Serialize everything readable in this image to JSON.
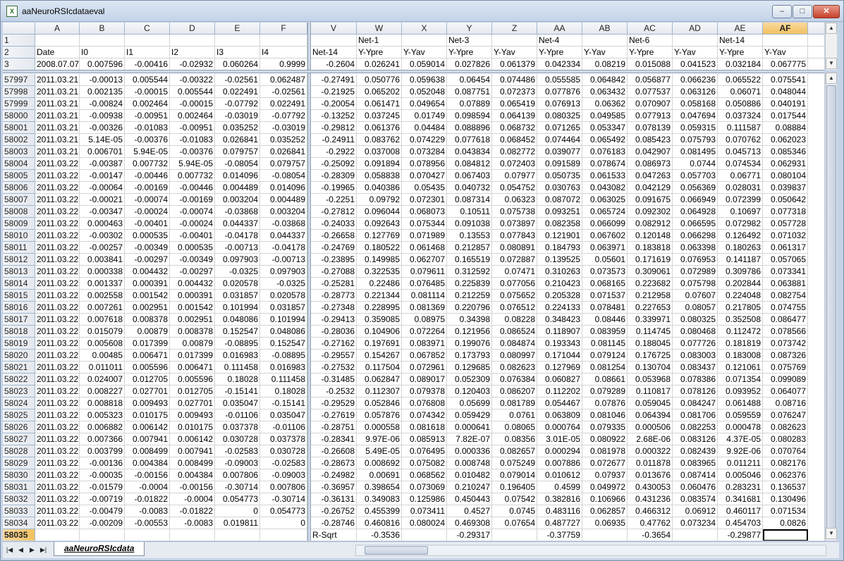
{
  "window": {
    "title": "aaNeuroRSIcdataeval",
    "app_icon": "excel-sheet-icon",
    "min_label": "–",
    "max_label": "□",
    "close_label": "✕"
  },
  "columns": [
    "A",
    "B",
    "C",
    "D",
    "E",
    "F",
    "V",
    "W",
    "X",
    "Y",
    "Z",
    "AA",
    "AB",
    "AC",
    "AD",
    "AE",
    "AF",
    "A"
  ],
  "selected_column": "AF",
  "header_rows": [
    {
      "n": "1",
      "cells": [
        "",
        "",
        "",
        "",
        "",
        "",
        "",
        "Net-1",
        "",
        "Net-3",
        "",
        "Net-4",
        "",
        "Net-6",
        "",
        "Net-14",
        "",
        ""
      ]
    },
    {
      "n": "2",
      "cells": [
        "Date",
        "I0",
        "I1",
        "I2",
        "I3",
        "I4",
        "Net-14",
        "Y-Ypre",
        "Y-Yav",
        "Y-Ypre",
        "Y-Yav",
        "Y-Ypre",
        "Y-Yav",
        "Y-Ypre",
        "Y-Yav",
        "Y-Ypre",
        "Y-Yav",
        ""
      ]
    },
    {
      "n": "3",
      "cells": [
        "2008.07.07",
        "0.007596",
        "-0.00416",
        "-0.02932",
        "0.060264",
        "0.9999",
        "-0.2604",
        "0.026241",
        "0.059014",
        "0.027826",
        "0.061379",
        "0.042334",
        "0.08219",
        "0.015088",
        "0.041523",
        "0.032184",
        "0.067775",
        ""
      ]
    }
  ],
  "data_rows": [
    {
      "n": "57997",
      "cells": [
        "2011.03.21",
        "-0.00013",
        "0.005544",
        "-0.00322",
        "-0.02561",
        "0.062487",
        "-0.27491",
        "0.050776",
        "0.059638",
        "0.06454",
        "0.074486",
        "0.055585",
        "0.064842",
        "0.056877",
        "0.066236",
        "0.065522",
        "0.075541"
      ]
    },
    {
      "n": "57998",
      "cells": [
        "2011.03.21",
        "0.002135",
        "-0.00015",
        "0.005544",
        "0.022491",
        "-0.02561",
        "-0.21925",
        "0.065202",
        "0.052048",
        "0.087751",
        "0.072373",
        "0.077876",
        "0.063432",
        "0.077537",
        "0.063126",
        "0.06071",
        "0.048044"
      ]
    },
    {
      "n": "57999",
      "cells": [
        "2011.03.21",
        "-0.00824",
        "0.002464",
        "-0.00015",
        "-0.07792",
        "0.022491",
        "-0.20054",
        "0.061471",
        "0.049654",
        "0.07889",
        "0.065419",
        "0.076913",
        "0.06362",
        "0.070907",
        "0.058168",
        "0.050886",
        "0.040191"
      ]
    },
    {
      "n": "58000",
      "cells": [
        "2011.03.21",
        "-0.00938",
        "-0.00951",
        "0.002464",
        "-0.03019",
        "-0.07792",
        "-0.13252",
        "0.037245",
        "0.01749",
        "0.098594",
        "0.064139",
        "0.080325",
        "0.049585",
        "0.077913",
        "0.047694",
        "0.037324",
        "0.017544"
      ]
    },
    {
      "n": "58001",
      "cells": [
        "2011.03.21",
        "-0.00326",
        "-0.01083",
        "-0.00951",
        "0.035252",
        "-0.03019",
        "-0.29812",
        "0.061376",
        "0.04484",
        "0.088896",
        "0.068732",
        "0.071265",
        "0.053347",
        "0.078139",
        "0.059315",
        "0.111587",
        "0.08884"
      ]
    },
    {
      "n": "58002",
      "cells": [
        "2011.03.21",
        "5.14E-05",
        "-0.00376",
        "-0.01083",
        "0.026841",
        "0.035252",
        "-0.24911",
        "0.083762",
        "0.074229",
        "0.077618",
        "0.068452",
        "0.074464",
        "0.065492",
        "0.085423",
        "0.075793",
        "0.070762",
        "0.062023"
      ]
    },
    {
      "n": "58003",
      "cells": [
        "2011.03.21",
        "0.006701",
        "5.94E-05",
        "-0.00376",
        "0.079757",
        "0.026841",
        "-0.2922",
        "0.037008",
        "0.073284",
        "0.043834",
        "0.082772",
        "0.039077",
        "0.076183",
        "0.042907",
        "0.081495",
        "0.045713",
        "0.085346"
      ]
    },
    {
      "n": "58004",
      "cells": [
        "2011.03.22",
        "-0.00387",
        "0.007732",
        "5.94E-05",
        "-0.08054",
        "0.079757",
        "-0.25092",
        "0.091894",
        "0.078956",
        "0.084812",
        "0.072403",
        "0.091589",
        "0.078674",
        "0.086973",
        "0.0744",
        "0.074534",
        "0.062931"
      ]
    },
    {
      "n": "58005",
      "cells": [
        "2011.03.22",
        "-0.00147",
        "-0.00446",
        "0.007732",
        "0.014096",
        "-0.08054",
        "-0.28309",
        "0.058838",
        "0.070427",
        "0.067403",
        "0.07977",
        "0.050735",
        "0.061533",
        "0.047263",
        "0.057703",
        "0.06771",
        "0.080104"
      ]
    },
    {
      "n": "58006",
      "cells": [
        "2011.03.22",
        "-0.00064",
        "-0.00169",
        "-0.00446",
        "0.004489",
        "0.014096",
        "-0.19965",
        "0.040386",
        "0.05435",
        "0.040732",
        "0.054752",
        "0.030763",
        "0.043082",
        "0.042129",
        "0.056369",
        "0.028031",
        "0.039837"
      ]
    },
    {
      "n": "58007",
      "cells": [
        "2011.03.22",
        "-0.00021",
        "-0.00074",
        "-0.00169",
        "0.003204",
        "0.004489",
        "-0.2251",
        "0.09792",
        "0.072301",
        "0.087314",
        "0.06323",
        "0.087072",
        "0.063025",
        "0.091675",
        "0.066949",
        "0.072399",
        "0.050642"
      ]
    },
    {
      "n": "58008",
      "cells": [
        "2011.03.22",
        "-0.00347",
        "-0.00024",
        "-0.00074",
        "-0.03868",
        "0.003204",
        "-0.27812",
        "0.096044",
        "0.068073",
        "0.10511",
        "0.075738",
        "0.093251",
        "0.065724",
        "0.092302",
        "0.064928",
        "0.10697",
        "0.077318"
      ]
    },
    {
      "n": "58009",
      "cells": [
        "2011.03.22",
        "0.000463",
        "-0.00401",
        "-0.00024",
        "0.044337",
        "-0.03868",
        "-0.24033",
        "0.092643",
        "0.075344",
        "0.091038",
        "0.073897",
        "0.082358",
        "0.066099",
        "0.082912",
        "0.066595",
        "0.072982",
        "0.057728"
      ]
    },
    {
      "n": "58010",
      "cells": [
        "2011.03.22",
        "-0.00302",
        "0.000535",
        "-0.00401",
        "-0.04178",
        "0.044337",
        "-0.26658",
        "0.127769",
        "0.071989",
        "0.13553",
        "0.077843",
        "0.121901",
        "0.067602",
        "0.120148",
        "0.066298",
        "0.126492",
        "0.071032"
      ]
    },
    {
      "n": "58011",
      "cells": [
        "2011.03.22",
        "-0.00257",
        "-0.00349",
        "0.000535",
        "-0.00713",
        "-0.04178",
        "-0.24769",
        "0.180522",
        "0.061468",
        "0.212857",
        "0.080891",
        "0.184793",
        "0.063971",
        "0.183818",
        "0.063398",
        "0.180263",
        "0.061317"
      ]
    },
    {
      "n": "58012",
      "cells": [
        "2011.03.22",
        "0.003841",
        "-0.00297",
        "-0.00349",
        "0.097903",
        "-0.00713",
        "-0.23895",
        "0.149985",
        "0.062707",
        "0.165519",
        "0.072887",
        "0.139525",
        "0.05601",
        "0.171619",
        "0.076953",
        "0.141187",
        "0.057065"
      ]
    },
    {
      "n": "58013",
      "cells": [
        "2011.03.22",
        "0.000338",
        "0.004432",
        "-0.00297",
        "-0.0325",
        "0.097903",
        "-0.27088",
        "0.322535",
        "0.079611",
        "0.312592",
        "0.07471",
        "0.310263",
        "0.073573",
        "0.309061",
        "0.072989",
        "0.309786",
        "0.073341"
      ]
    },
    {
      "n": "58014",
      "cells": [
        "2011.03.22",
        "0.001337",
        "0.000391",
        "0.004432",
        "0.020578",
        "-0.0325",
        "-0.25281",
        "0.22486",
        "0.076485",
        "0.225839",
        "0.077056",
        "0.210423",
        "0.068165",
        "0.223682",
        "0.075798",
        "0.202844",
        "0.063881"
      ]
    },
    {
      "n": "58015",
      "cells": [
        "2011.03.22",
        "0.002558",
        "0.001542",
        "0.000391",
        "0.031857",
        "0.020578",
        "-0.28773",
        "0.221344",
        "0.081114",
        "0.212259",
        "0.075652",
        "0.205328",
        "0.071537",
        "0.212958",
        "0.07607",
        "0.224048",
        "0.082754"
      ]
    },
    {
      "n": "58016",
      "cells": [
        "2011.03.22",
        "0.007261",
        "0.002951",
        "0.001542",
        "0.101994",
        "0.031857",
        "-0.27348",
        "0.228995",
        "0.081369",
        "0.220796",
        "0.076512",
        "0.224133",
        "0.078481",
        "0.227653",
        "0.08057",
        "0.217805",
        "0.074755"
      ]
    },
    {
      "n": "58017",
      "cells": [
        "2011.03.22",
        "0.007618",
        "0.008378",
        "0.002951",
        "0.048086",
        "0.101994",
        "-0.29413",
        "0.359085",
        "0.08975",
        "0.34398",
        "0.08228",
        "0.348423",
        "0.08446",
        "0.339971",
        "0.080325",
        "0.352508",
        "0.086477"
      ]
    },
    {
      "n": "58018",
      "cells": [
        "2011.03.22",
        "0.015079",
        "0.00879",
        "0.008378",
        "0.152547",
        "0.048086",
        "-0.28036",
        "0.104906",
        "0.072264",
        "0.121956",
        "0.086524",
        "0.118907",
        "0.083959",
        "0.114745",
        "0.080468",
        "0.112472",
        "0.078566"
      ]
    },
    {
      "n": "58019",
      "cells": [
        "2011.03.22",
        "0.005608",
        "0.017399",
        "0.00879",
        "-0.08895",
        "0.152547",
        "-0.27162",
        "0.197691",
        "0.083971",
        "0.199076",
        "0.084874",
        "0.193343",
        "0.081145",
        "0.188045",
        "0.077726",
        "0.181819",
        "0.073742"
      ]
    },
    {
      "n": "58020",
      "cells": [
        "2011.03.22",
        "0.00485",
        "0.006471",
        "0.017399",
        "0.016983",
        "-0.08895",
        "-0.29557",
        "0.154267",
        "0.067852",
        "0.173793",
        "0.080997",
        "0.171044",
        "0.079124",
        "0.176725",
        "0.083003",
        "0.183008",
        "0.087326"
      ]
    },
    {
      "n": "58021",
      "cells": [
        "2011.03.22",
        "0.011011",
        "0.005596",
        "0.006471",
        "0.111458",
        "0.016983",
        "-0.27532",
        "0.117504",
        "0.072961",
        "0.129685",
        "0.082623",
        "0.127969",
        "0.081254",
        "0.130704",
        "0.083437",
        "0.121061",
        "0.075769"
      ]
    },
    {
      "n": "58022",
      "cells": [
        "2011.03.22",
        "0.024007",
        "0.012705",
        "0.005596",
        "0.18028",
        "0.111458",
        "-0.31485",
        "0.062847",
        "0.089017",
        "0.052309",
        "0.076384",
        "0.060827",
        "0.08661",
        "0.053968",
        "0.078386",
        "0.071354",
        "0.099089"
      ]
    },
    {
      "n": "58023",
      "cells": [
        "2011.03.22",
        "0.008227",
        "0.027701",
        "0.012705",
        "-0.15141",
        "0.18028",
        "-0.2532",
        "0.112307",
        "0.079378",
        "0.120403",
        "0.086207",
        "0.112202",
        "0.079289",
        "0.110817",
        "0.078126",
        "0.093952",
        "0.064077"
      ]
    },
    {
      "n": "58024",
      "cells": [
        "2011.03.22",
        "0.008818",
        "0.009493",
        "0.027701",
        "0.035047",
        "-0.15141",
        "-0.29529",
        "0.052846",
        "0.076808",
        "0.05699",
        "0.081789",
        "0.054467",
        "0.07876",
        "0.059045",
        "0.084247",
        "0.061488",
        "0.08716"
      ]
    },
    {
      "n": "58025",
      "cells": [
        "2011.03.22",
        "0.005323",
        "0.010175",
        "0.009493",
        "-0.01106",
        "0.035047",
        "-0.27619",
        "0.057876",
        "0.074342",
        "0.059429",
        "0.0761",
        "0.063809",
        "0.081046",
        "0.064394",
        "0.081706",
        "0.059559",
        "0.076247"
      ]
    },
    {
      "n": "58026",
      "cells": [
        "2011.03.22",
        "0.006882",
        "0.006142",
        "0.010175",
        "0.037378",
        "-0.01106",
        "-0.28751",
        "0.000558",
        "0.081618",
        "0.000641",
        "0.08065",
        "0.000764",
        "0.079335",
        "0.000506",
        "0.082253",
        "0.000478",
        "0.082623"
      ]
    },
    {
      "n": "58027",
      "cells": [
        "2011.03.22",
        "0.007366",
        "0.007941",
        "0.006142",
        "0.030728",
        "0.037378",
        "-0.28341",
        "9.97E-06",
        "0.085913",
        "7.82E-07",
        "0.08356",
        "3.01E-05",
        "0.080922",
        "2.68E-06",
        "0.083126",
        "4.37E-05",
        "0.080283"
      ]
    },
    {
      "n": "58028",
      "cells": [
        "2011.03.22",
        "0.003799",
        "0.008499",
        "0.007941",
        "-0.02583",
        "0.030728",
        "-0.26608",
        "5.49E-05",
        "0.076495",
        "0.000336",
        "0.082657",
        "0.000294",
        "0.081978",
        "0.000322",
        "0.082439",
        "9.92E-06",
        "0.070764"
      ]
    },
    {
      "n": "58029",
      "cells": [
        "2011.03.22",
        "-0.00136",
        "0.004384",
        "0.008499",
        "-0.09003",
        "-0.02583",
        "-0.28673",
        "0.008692",
        "0.075082",
        "0.008748",
        "0.075249",
        "0.007886",
        "0.072677",
        "0.011878",
        "0.083965",
        "0.011211",
        "0.082176"
      ]
    },
    {
      "n": "58030",
      "cells": [
        "2011.03.22",
        "-0.00035",
        "-0.00156",
        "0.004384",
        "0.007806",
        "-0.09003",
        "-0.24982",
        "0.00691",
        "0.068562",
        "0.010482",
        "0.079014",
        "0.010612",
        "0.07937",
        "0.013676",
        "0.087414",
        "0.005046",
        "0.062376"
      ]
    },
    {
      "n": "58031",
      "cells": [
        "2011.03.22",
        "-0.01579",
        "-0.0004",
        "-0.00156",
        "-0.30714",
        "0.007806",
        "-0.36957",
        "0.398654",
        "0.073069",
        "0.210247",
        "0.196405",
        "0.4599",
        "0.049972",
        "0.430053",
        "0.060476",
        "0.283231",
        "0.136537"
      ]
    },
    {
      "n": "58032",
      "cells": [
        "2011.03.22",
        "-0.00719",
        "-0.01822",
        "-0.0004",
        "0.054773",
        "-0.30714",
        "-0.36131",
        "0.349083",
        "0.125986",
        "0.450443",
        "0.07542",
        "0.382816",
        "0.106966",
        "0.431236",
        "0.083574",
        "0.341681",
        "0.130496"
      ]
    },
    {
      "n": "58033",
      "cells": [
        "2011.03.22",
        "-0.00479",
        "-0.0083",
        "-0.01822",
        "0",
        "0.054773",
        "-0.26752",
        "0.455399",
        "0.073411",
        "0.4527",
        "0.0745",
        "0.483116",
        "0.062857",
        "0.466312",
        "0.06912",
        "0.460117",
        "0.071534"
      ]
    },
    {
      "n": "58034",
      "cells": [
        "2011.03.22",
        "-0.00209",
        "-0.00553",
        "-0.0083",
        "0.019811",
        "0",
        "-0.28746",
        "0.460816",
        "0.080024",
        "0.469308",
        "0.07654",
        "0.487727",
        "0.06935",
        "0.47762",
        "0.073234",
        "0.454703",
        "0.0826"
      ]
    },
    {
      "n": "58035",
      "cells": [
        "",
        "",
        "",
        "",
        "",
        "",
        "R-Sqrt",
        "-0.3536",
        "",
        "-0.29317",
        "",
        "-0.37759",
        "",
        "-0.3654",
        "",
        "-0.29877",
        ""
      ]
    }
  ],
  "selected_row": "58035",
  "sheet_tab": "aaNeuroRSIcdata",
  "tab_nav": [
    "|◀",
    "◀",
    "▶",
    "▶|"
  ]
}
